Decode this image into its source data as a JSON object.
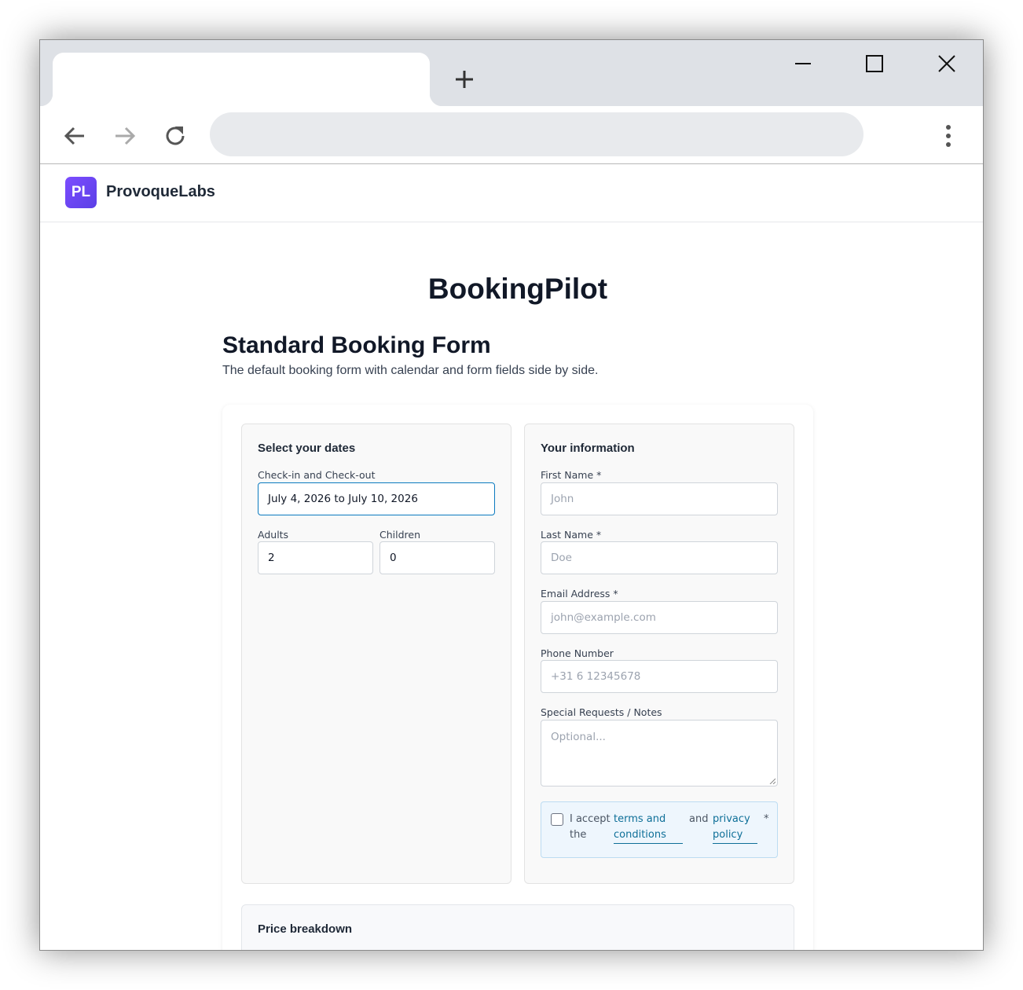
{
  "browser": {
    "new_tab_icon": "plus-icon",
    "controls": [
      "minimize-icon",
      "maximize-icon",
      "close-icon"
    ],
    "nav": [
      "back-arrow-icon",
      "forward-arrow-icon",
      "reload-icon"
    ],
    "menu_icon": "kebab-menu-icon"
  },
  "site": {
    "logo_initials": "PL",
    "brand_name": "ProvoqueLabs"
  },
  "page": {
    "app_title": "BookingPilot",
    "form_title": "Standard Booking Form",
    "form_description": "The default booking form with calendar and form fields side by side."
  },
  "dates_panel": {
    "title": "Select your dates",
    "date_label": "Check-in and Check-out",
    "date_value": "July 4, 2026 to July 10, 2026",
    "adults_label": "Adults",
    "adults_value": "2",
    "children_label": "Children",
    "children_value": "0"
  },
  "info_panel": {
    "title": "Your information",
    "first_name_label": "First Name *",
    "first_name_placeholder": "John",
    "last_name_label": "Last Name *",
    "last_name_placeholder": "Doe",
    "email_label": "Email Address *",
    "email_placeholder": "john@example.com",
    "phone_label": "Phone Number",
    "phone_placeholder": "+31 6 12345678",
    "notes_label": "Special Requests / Notes",
    "notes_placeholder": "Optional...",
    "terms": {
      "i_accept": "I accept",
      "the": "the",
      "terms_link_1": "terms and",
      "terms_link_2": "conditions",
      "and": "and",
      "privacy_link_1": "privacy",
      "privacy_link_2": "policy",
      "required_mark": "*"
    }
  },
  "price": {
    "title": "Price breakdown"
  },
  "colors": {
    "accent": "#0b7abf",
    "link": "#0e6f98",
    "logo_gradient_start": "#7c4dff",
    "logo_gradient_end": "#5b3fe6"
  }
}
